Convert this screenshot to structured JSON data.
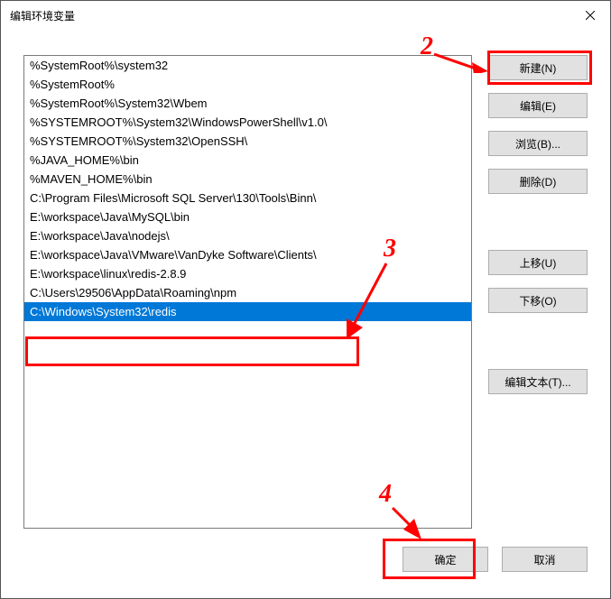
{
  "title": "编辑环境变量",
  "list": {
    "items": [
      "%SystemRoot%\\system32",
      "%SystemRoot%",
      "%SystemRoot%\\System32\\Wbem",
      "%SYSTEMROOT%\\System32\\WindowsPowerShell\\v1.0\\",
      "%SYSTEMROOT%\\System32\\OpenSSH\\",
      "%JAVA_HOME%\\bin",
      "%MAVEN_HOME%\\bin",
      "C:\\Program Files\\Microsoft SQL Server\\130\\Tools\\Binn\\",
      "E:\\workspace\\Java\\MySQL\\bin",
      "E:\\workspace\\Java\\nodejs\\",
      "E:\\workspace\\Java\\VMware\\VanDyke Software\\Clients\\",
      "E:\\workspace\\linux\\redis-2.8.9",
      "C:\\Users\\29506\\AppData\\Roaming\\npm",
      "C:\\Windows\\System32\\redis"
    ],
    "selected_index": 13
  },
  "buttons": {
    "new": "新建(N)",
    "edit": "编辑(E)",
    "browse": "浏览(B)...",
    "delete": "删除(D)",
    "move_up": "上移(U)",
    "move_down": "下移(O)",
    "edit_text": "编辑文本(T)...",
    "ok": "确定",
    "cancel": "取消"
  },
  "annotations": {
    "step2": "2",
    "step3": "3",
    "step4": "4"
  }
}
